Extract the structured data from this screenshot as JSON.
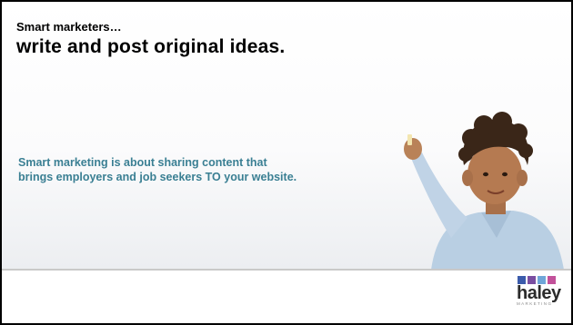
{
  "slide": {
    "kicker": "Smart marketers…",
    "headline": "write and post original ideas.",
    "body_line1": "Smart marketing is about sharing content that",
    "body_line2": "brings employers and job seekers TO your website."
  },
  "logo": {
    "wordmark": "haley",
    "tagline": "MARKETING",
    "square_colors": [
      "#3b5bab",
      "#7a4ea1",
      "#6fa6d8",
      "#c2519a"
    ]
  },
  "colors": {
    "body_text": "#3a7f93",
    "heading_text": "#000000"
  }
}
